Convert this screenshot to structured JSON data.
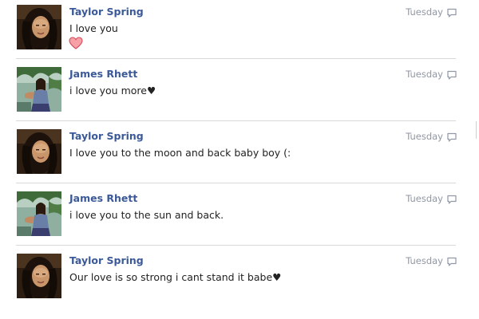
{
  "messages": [
    {
      "sender": "Taylor Spring",
      "text": "I love you",
      "has_heart_emoji": true,
      "time": "Tuesday",
      "avatar": "taylor-spring-avatar"
    },
    {
      "sender": "James Rhett",
      "text": "i love you more♥",
      "has_heart_emoji": false,
      "time": "Tuesday",
      "avatar": "james-rhett-avatar"
    },
    {
      "sender": "Taylor Spring",
      "text": "I love you to the moon and back baby boy (:",
      "has_heart_emoji": false,
      "time": "Tuesday",
      "avatar": "taylor-spring-avatar"
    },
    {
      "sender": "James Rhett",
      "text": "i love you to the sun and back.",
      "has_heart_emoji": false,
      "time": "Tuesday",
      "avatar": "james-rhett-avatar"
    },
    {
      "sender": "Taylor Spring",
      "text": "Our love is so strong i cant stand it babe♥",
      "has_heart_emoji": false,
      "time": "Tuesday",
      "avatar": "taylor-spring-avatar"
    }
  ],
  "colors": {
    "sender_name": "#3b5998",
    "message_text": "#222222",
    "timestamp": "#9197a3",
    "divider": "#d9d9d9",
    "heart_fill": "#f7a1a6",
    "heart_stroke": "#d24a58"
  },
  "icons": {
    "reply": "speech-bubble-icon",
    "emoji": "heart-emoji-icon"
  }
}
